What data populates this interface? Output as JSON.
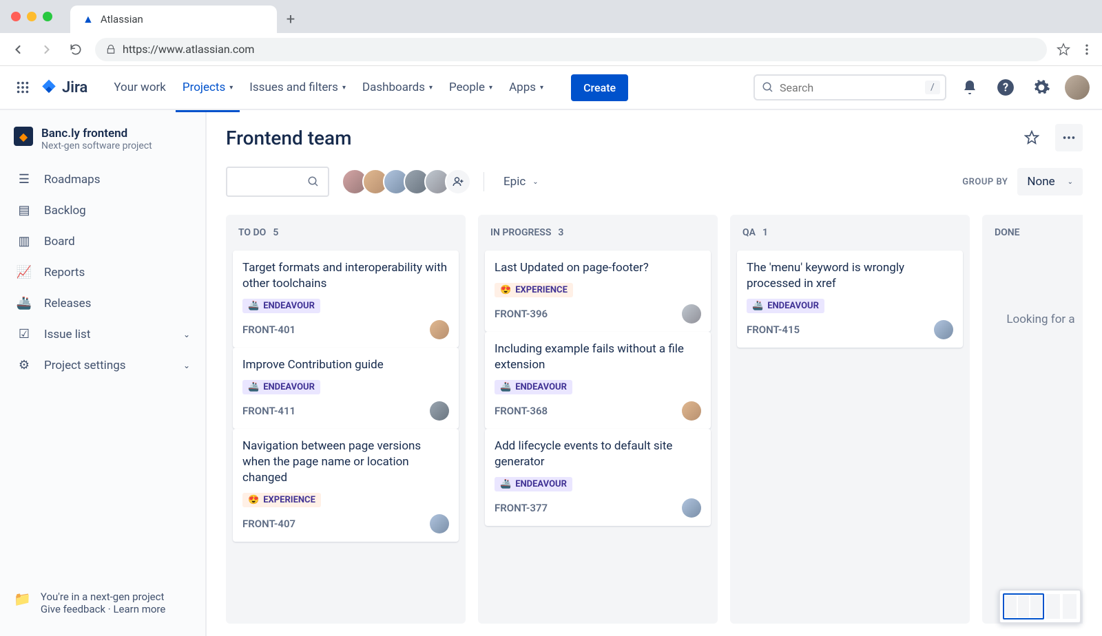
{
  "browser": {
    "tab_title": "Atlassian",
    "url": "https://www.atlassian.com"
  },
  "nav": {
    "your_work": "Your work",
    "projects": "Projects",
    "issues": "Issues and filters",
    "dashboards": "Dashboards",
    "people": "People",
    "apps": "Apps",
    "create": "Create",
    "search_placeholder": "Search",
    "slash": "/"
  },
  "sidebar": {
    "project_name": "Banc.ly frontend",
    "project_type": "Next-gen software project",
    "items": {
      "roadmaps": "Roadmaps",
      "backlog": "Backlog",
      "board": "Board",
      "reports": "Reports",
      "releases": "Releases",
      "issue_list": "Issue list",
      "settings": "Project settings"
    },
    "footer_line1": "You're in a next-gen project",
    "footer_feedback": "Give feedback",
    "footer_dot": " · ",
    "footer_learn": "Learn more"
  },
  "board": {
    "title": "Frontend team",
    "epic_label": "Epic",
    "group_by_label": "GROUP BY",
    "group_by_value": "None",
    "columns": {
      "todo": {
        "name": "TO DO",
        "count": "5"
      },
      "inprogress": {
        "name": "IN PROGRESS",
        "count": "3"
      },
      "qa": {
        "name": "QA",
        "count": "1"
      },
      "done": {
        "name": "DONE",
        "empty": "Looking for a"
      }
    }
  },
  "epics": {
    "endeavour": "ENDEAVOUR",
    "experience": "EXPERIENCE"
  },
  "cards": {
    "todo": [
      {
        "title": "Target formats and interoperability with other toolchains",
        "epic": "endeavour",
        "emoji": "🚢",
        "key": "FRONT-401",
        "av": "av2"
      },
      {
        "title": "Improve Contribution guide",
        "epic": "endeavour",
        "emoji": "🚢",
        "key": "FRONT-411",
        "av": "av4"
      },
      {
        "title": "Navigation between page versions when the page name or location changed",
        "epic": "experience",
        "emoji": "😍",
        "key": "FRONT-407",
        "av": "av3"
      }
    ],
    "inprogress": [
      {
        "title": "Last Updated on page-footer?",
        "epic": "experience",
        "emoji": "😍",
        "key": "FRONT-396",
        "av": "av5"
      },
      {
        "title": "Including example fails without a file extension",
        "epic": "endeavour",
        "emoji": "🚢",
        "key": "FRONT-368",
        "av": "av2"
      },
      {
        "title": "Add lifecycle events to default site generator",
        "epic": "endeavour",
        "emoji": "🚢",
        "key": "FRONT-377",
        "av": "av3"
      }
    ],
    "qa": [
      {
        "title": "The 'menu' keyword is wrongly processed in xref",
        "epic": "endeavour",
        "emoji": "🚢",
        "key": "FRONT-415",
        "av": "av3"
      }
    ]
  }
}
